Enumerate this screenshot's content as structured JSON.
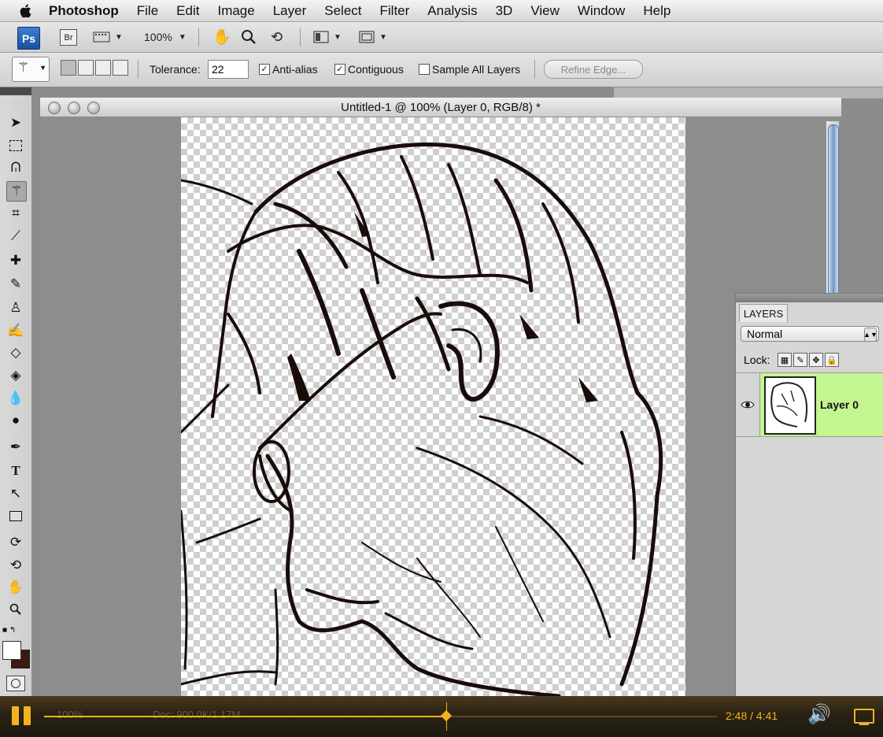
{
  "menubar": {
    "items": [
      "Photoshop",
      "File",
      "Edit",
      "Image",
      "Layer",
      "Select",
      "Filter",
      "Analysis",
      "3D",
      "View",
      "Window",
      "Help"
    ]
  },
  "appbar": {
    "ps_label": "Ps",
    "br_label": "Br",
    "zoom": "100%"
  },
  "options": {
    "tolerance_label": "Tolerance:",
    "tolerance_value": "22",
    "anti_alias": "Anti-alias",
    "contiguous": "Contiguous",
    "sample_all": "Sample All Layers",
    "refine_edge": "Refine Edge..."
  },
  "document": {
    "title": "Untitled-1 @ 100% (Layer 0, RGB/8) *"
  },
  "layers_panel": {
    "tab": "LAYERS",
    "blend_mode": "Normal",
    "lock_label": "Lock:",
    "layer_name": "Layer 0"
  },
  "status": {
    "zoom": "100%",
    "doc": "Doc: 900.0K/1.17M"
  },
  "video": {
    "time": "2:48 / 4:41",
    "progress": 0.5977
  }
}
